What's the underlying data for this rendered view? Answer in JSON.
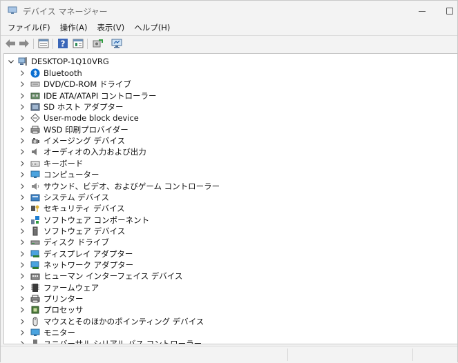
{
  "window": {
    "title": "デバイス マネージャー"
  },
  "menu": [
    "ファイル(F)",
    "操作(A)",
    "表示(V)",
    "ヘルプ(H)"
  ],
  "toolbar": {
    "buttons": [
      "back-arrow-icon",
      "forward-arrow-icon",
      "properties-icon",
      "help-icon",
      "view-icon",
      "update-driver-icon",
      "monitor-scan-icon"
    ]
  },
  "tree": {
    "root": {
      "label": "DESKTOP-1Q10VRG",
      "icon": "computer-icon",
      "expanded": true
    },
    "categories": [
      {
        "label": "Bluetooth",
        "icon": "bluetooth-icon"
      },
      {
        "label": "DVD/CD-ROM ドライブ",
        "icon": "dvd-drive-icon"
      },
      {
        "label": "IDE ATA/ATAPI コントローラー",
        "icon": "ide-controller-icon"
      },
      {
        "label": "SD ホスト アダプター",
        "icon": "sd-host-icon"
      },
      {
        "label": "User-mode block device",
        "icon": "block-device-icon"
      },
      {
        "label": "WSD 印刷プロバイダー",
        "icon": "printer-icon"
      },
      {
        "label": "イメージング デバイス",
        "icon": "camera-icon"
      },
      {
        "label": "オーディオの入力および出力",
        "icon": "speaker-icon"
      },
      {
        "label": "キーボード",
        "icon": "keyboard-icon"
      },
      {
        "label": "コンピューター",
        "icon": "computer-monitor-icon"
      },
      {
        "label": "サウンド、ビデオ、およびゲーム コントローラー",
        "icon": "sound-icon"
      },
      {
        "label": "システム デバイス",
        "icon": "system-folder-icon"
      },
      {
        "label": "セキュリティ デバイス",
        "icon": "security-key-icon"
      },
      {
        "label": "ソフトウェア コンポーネント",
        "icon": "software-component-icon"
      },
      {
        "label": "ソフトウェア デバイス",
        "icon": "software-device-icon"
      },
      {
        "label": "ディスク ドライブ",
        "icon": "disk-drive-icon"
      },
      {
        "label": "ディスプレイ アダプター",
        "icon": "display-adapter-icon"
      },
      {
        "label": "ネットワーク アダプター",
        "icon": "network-adapter-icon"
      },
      {
        "label": "ヒューマン インターフェイス デバイス",
        "icon": "hid-icon"
      },
      {
        "label": "ファームウェア",
        "icon": "firmware-icon"
      },
      {
        "label": "プリンター",
        "icon": "printer-device-icon"
      },
      {
        "label": "プロセッサ",
        "icon": "processor-icon"
      },
      {
        "label": "マウスとそのほかのポインティング デバイス",
        "icon": "mouse-icon"
      },
      {
        "label": "モニター",
        "icon": "monitor-icon"
      },
      {
        "label": "ユニバーサル シリアル バス コントローラー",
        "icon": "usb-icon"
      }
    ]
  },
  "colors": {
    "accent_blue": "#0a6ed1",
    "teal": "#1a8fc6",
    "gray_icon": "#6b6b6b"
  }
}
